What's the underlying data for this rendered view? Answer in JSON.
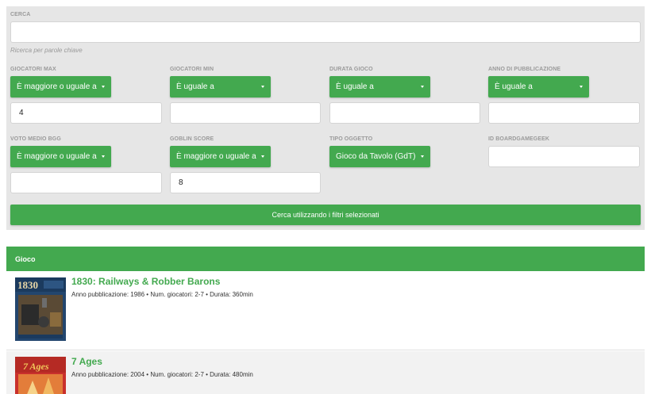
{
  "search": {
    "label": "CERCA",
    "value": "",
    "help": "Ricerca per parole chiave"
  },
  "filters": {
    "giocatori_max": {
      "label": "GIOCATORI MAX",
      "operator": "È maggiore o uguale a",
      "value": "4"
    },
    "giocatori_min": {
      "label": "GIOCATORI MIN",
      "operator": "È uguale a",
      "value": ""
    },
    "durata_gioco": {
      "label": "DURATA GIOCO",
      "operator": "È uguale a",
      "value": ""
    },
    "anno_pubblicazione": {
      "label": "ANNO DI PUBBLICAZIONE",
      "operator": "È uguale a",
      "value": ""
    },
    "voto_medio_bgg": {
      "label": "VOTO MEDIO BGG",
      "operator": "È maggiore o uguale a",
      "value": ""
    },
    "goblin_score": {
      "label": "GOBLIN SCORE",
      "operator": "È maggiore o uguale a",
      "value": "8"
    },
    "tipo_oggetto": {
      "label": "TIPO OGGETTO",
      "operator": "Gioco da Tavolo (GdT)"
    },
    "id_boardgamegeek": {
      "label": "ID BOARDGAMEGEEK",
      "value": ""
    }
  },
  "search_button_label": "Cerca utilizzando i filtri selezionati",
  "results": {
    "header": "Gioco",
    "items": [
      {
        "title": "1830: Railways & Robber Barons",
        "meta": "Anno pubblicazione: 1986 • Num. giocatori: 2-7 • Durata: 360min",
        "cover_text": "1830"
      },
      {
        "title": "7 Ages",
        "meta": "Anno pubblicazione: 2004 • Num. giocatori: 2-7 • Durata: 480min",
        "cover_text": "7 Ages"
      }
    ]
  },
  "colors": {
    "accent": "#43a94f",
    "panel": "#e6e6e6",
    "muted": "#9a9a9a"
  }
}
